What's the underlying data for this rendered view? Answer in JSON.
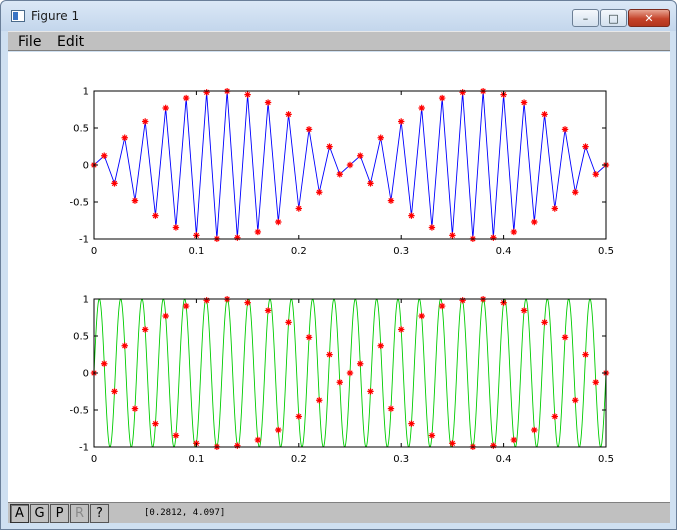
{
  "window": {
    "title": "Figure 1",
    "controls": {
      "minimize": "–",
      "maximize": "□",
      "close": "✕"
    }
  },
  "menu": {
    "file": "File",
    "edit": "Edit"
  },
  "statusbar": {
    "buttons": [
      {
        "label": "A",
        "state": "pressed"
      },
      {
        "label": "G",
        "state": "normal"
      },
      {
        "label": "P",
        "state": "normal"
      },
      {
        "label": "R",
        "state": "disabled"
      },
      {
        "label": "?",
        "state": "normal"
      }
    ],
    "coords": "[0.2812, 4.097]"
  },
  "chart_data": [
    {
      "type": "line",
      "title": "",
      "xlabel": "",
      "ylabel": "",
      "xlim": [
        0,
        0.5
      ],
      "ylim": [
        -1,
        1
      ],
      "xticks": [
        "0",
        "0.1",
        "0.2",
        "0.3",
        "0.4",
        "0.5"
      ],
      "yticks": [
        "1",
        "0.5",
        "0",
        "-0.5",
        "-1"
      ],
      "series": [
        {
          "color": "#0000ff",
          "marker": "*",
          "marker_color": "#ff0000",
          "line": true,
          "formula": "sin(2*pi*48*t)",
          "t_step": 0.01,
          "t_range": [
            0,
            0.5
          ]
        }
      ]
    },
    {
      "type": "line",
      "title": "",
      "xlabel": "",
      "ylabel": "",
      "xlim": [
        0,
        0.5
      ],
      "ylim": [
        -1,
        1
      ],
      "xticks": [
        "0",
        "0.1",
        "0.2",
        "0.3",
        "0.4",
        "0.5"
      ],
      "yticks": [
        "1",
        "0.5",
        "0",
        "-0.5",
        "-1"
      ],
      "series": [
        {
          "color": "#00cc00",
          "line": true,
          "formula": "sin(2*pi*48*t)",
          "t_range": [
            0,
            0.5
          ]
        },
        {
          "marker": "*",
          "marker_color": "#ff0000",
          "line": false,
          "formula": "sin(2*pi*48*t)",
          "t_step": 0.01,
          "t_range": [
            0,
            0.5
          ]
        }
      ]
    }
  ]
}
